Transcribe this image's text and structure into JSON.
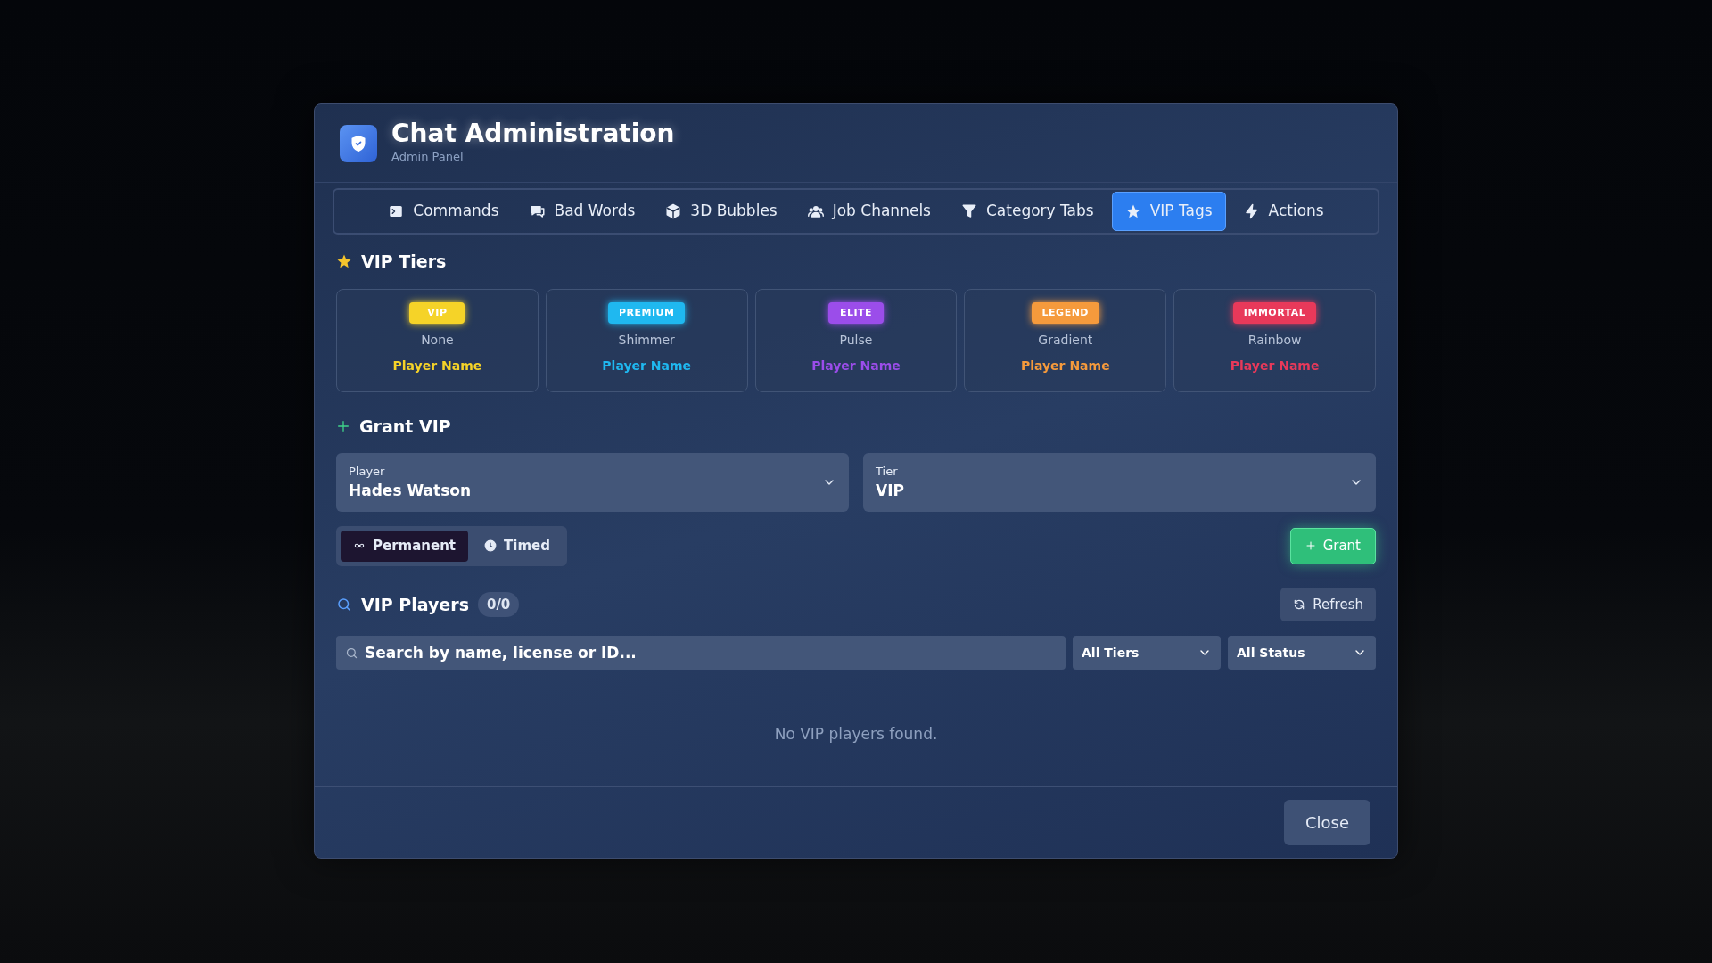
{
  "header": {
    "title": "Chat Administration",
    "subtitle": "Admin Panel"
  },
  "tabs": [
    {
      "label": "Commands",
      "selected": false
    },
    {
      "label": "Bad Words",
      "selected": false
    },
    {
      "label": "3D Bubbles",
      "selected": false
    },
    {
      "label": "Job Channels",
      "selected": false
    },
    {
      "label": "Category Tabs",
      "selected": false
    },
    {
      "label": "VIP Tags",
      "selected": true
    },
    {
      "label": "Actions",
      "selected": false
    }
  ],
  "tiers_section": {
    "title": "VIP Tiers"
  },
  "tiers": [
    {
      "badge": "VIP",
      "effect": "None",
      "sample": "Player Name",
      "color": "#f5d328"
    },
    {
      "badge": "PREMIUM",
      "effect": "Shimmer",
      "sample": "Player Name",
      "color": "#1fb8f0"
    },
    {
      "badge": "ELITE",
      "effect": "Pulse",
      "sample": "Player Name",
      "color": "#9b4dea"
    },
    {
      "badge": "LEGEND",
      "effect": "Gradient",
      "sample": "Player Name",
      "color": "#f59a3c"
    },
    {
      "badge": "IMMORTAL",
      "effect": "Rainbow",
      "sample": "Player Name",
      "color": "#e8395a"
    }
  ],
  "grant": {
    "title": "Grant VIP",
    "fields": [
      {
        "label": "Player",
        "value": "Hades Watson"
      },
      {
        "label": "Tier",
        "value": "VIP"
      }
    ],
    "modes": [
      {
        "label": "Permanent",
        "selected": true
      },
      {
        "label": "Timed",
        "selected": false
      }
    ],
    "button": "Grant"
  },
  "players": {
    "title": "VIP Players",
    "count": "0/0",
    "refresh": "Refresh",
    "search": {
      "placeholder": "Search by name, license or ID..."
    },
    "filters": [
      "All Tiers",
      "All Status"
    ],
    "empty": "No VIP players found."
  },
  "footer": {
    "close": "Close"
  }
}
